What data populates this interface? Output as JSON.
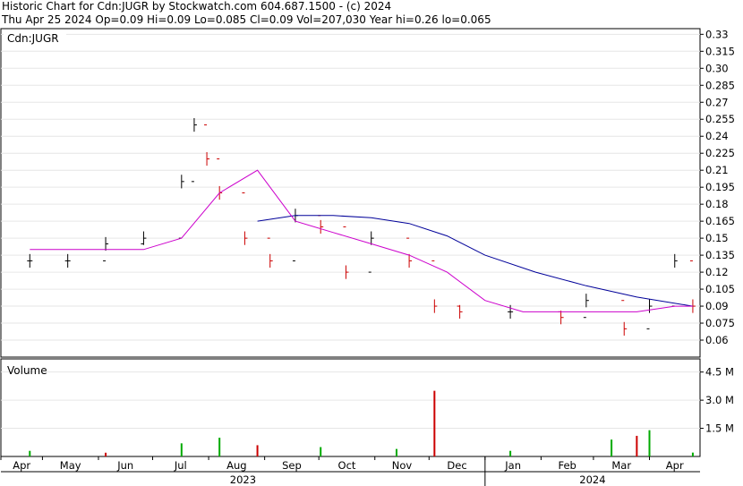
{
  "header": {
    "line1": "Historic Chart for Cdn:JUGR by Stockwatch.com 604.687.1500 - (c) 2024",
    "line2": "Thu Apr 25 2024  Op=0.09  Hi=0.09  Lo=0.085  Cl=0.09  Vol=207,030  Year hi=0.26  lo=0.065"
  },
  "colors": {
    "up_bar": "#000000",
    "down_bar": "#cc0000",
    "ma_short": "#cc00cc",
    "ma_long": "#000099",
    "volume_up": "#00aa00",
    "volume_down": "#cc0000",
    "grid": "#e6e6e6"
  },
  "chart_data": [
    {
      "type": "line",
      "panel": "price",
      "label": "Cdn:JUGR",
      "symbol": "Cdn:JUGR",
      "y_ticks": [
        "0.33",
        "0.315",
        "0.30",
        "0.285",
        "0.27",
        "0.255",
        "0.24",
        "0.225",
        "0.21",
        "0.195",
        "0.18",
        "0.165",
        "0.15",
        "0.135",
        "0.12",
        "0.105",
        "0.09",
        "0.075",
        "0.06"
      ],
      "ylim": [
        0.045,
        0.335
      ],
      "grid": true,
      "series": [
        {
          "style": "hlc-bars",
          "x": [
            "2023-04-24",
            "2023-05-15",
            "2023-06-05",
            "2023-06-26",
            "2023-07-17",
            "2023-07-24",
            "2023-07-31",
            "2023-08-07",
            "2023-08-21",
            "2023-09-04",
            "2023-09-18",
            "2023-10-02",
            "2023-10-16",
            "2023-10-30",
            "2023-11-20",
            "2023-12-04",
            "2023-12-18",
            "2024-01-15",
            "2024-02-12",
            "2024-02-26",
            "2024-03-18",
            "2024-04-01",
            "2024-04-15",
            "2024-04-25"
          ],
          "values": [
            0.13,
            0.13,
            0.145,
            0.15,
            0.2,
            0.25,
            0.22,
            0.19,
            0.15,
            0.13,
            0.17,
            0.16,
            0.12,
            0.15,
            0.13,
            0.09,
            0.085,
            0.085,
            0.08,
            0.095,
            0.07,
            0.09,
            0.13,
            0.09
          ]
        },
        {
          "name": "",
          "style": "moving-average-short",
          "x": [
            "2023-04-24",
            "2023-05-15",
            "2023-06-05",
            "2023-06-26",
            "2023-07-17",
            "2023-08-07",
            "2023-08-28",
            "2023-09-18",
            "2023-10-09",
            "2023-10-30",
            "2023-11-20",
            "2023-12-11",
            "2024-01-01",
            "2024-01-22",
            "2024-02-12",
            "2024-03-04",
            "2024-03-25",
            "2024-04-15",
            "2024-04-25"
          ],
          "values": [
            0.14,
            0.14,
            0.14,
            0.14,
            0.15,
            0.19,
            0.21,
            0.165,
            0.155,
            0.145,
            0.135,
            0.12,
            0.095,
            0.085,
            0.085,
            0.085,
            0.085,
            0.09,
            0.09
          ]
        },
        {
          "name": "",
          "style": "moving-average-long",
          "x": [
            "2023-08-28",
            "2023-09-18",
            "2023-10-09",
            "2023-10-30",
            "2023-11-20",
            "2023-12-11",
            "2024-01-01",
            "2024-01-29",
            "2024-02-26",
            "2024-03-25",
            "2024-04-25"
          ],
          "values": [
            0.165,
            0.17,
            0.17,
            0.168,
            0.163,
            0.152,
            0.135,
            0.12,
            0.108,
            0.098,
            0.09
          ]
        }
      ]
    },
    {
      "type": "bar",
      "panel": "volume",
      "label": "Volume",
      "y_ticks": [
        "4.5 M",
        "3.0 M",
        "1.5 M"
      ],
      "ylim": [
        0,
        5200000
      ],
      "x": [
        "2023-04-24",
        "2023-06-05",
        "2023-07-17",
        "2023-08-07",
        "2023-08-28",
        "2023-10-02",
        "2023-11-13",
        "2023-12-04",
        "2024-01-15",
        "2024-03-11",
        "2024-03-25",
        "2024-04-01",
        "2024-04-25"
      ],
      "values": [
        300000,
        200000,
        700000,
        1000000,
        600000,
        500000,
        400000,
        3500000,
        300000,
        900000,
        1100000,
        1400000,
        207030
      ]
    }
  ],
  "x_axis": {
    "months": [
      "Apr",
      "May",
      "Jun",
      "Jul",
      "Aug",
      "Sep",
      "Oct",
      "Nov",
      "Dec",
      "Jan",
      "Feb",
      "Mar",
      "Apr"
    ],
    "years": [
      "2023",
      "2024"
    ]
  }
}
